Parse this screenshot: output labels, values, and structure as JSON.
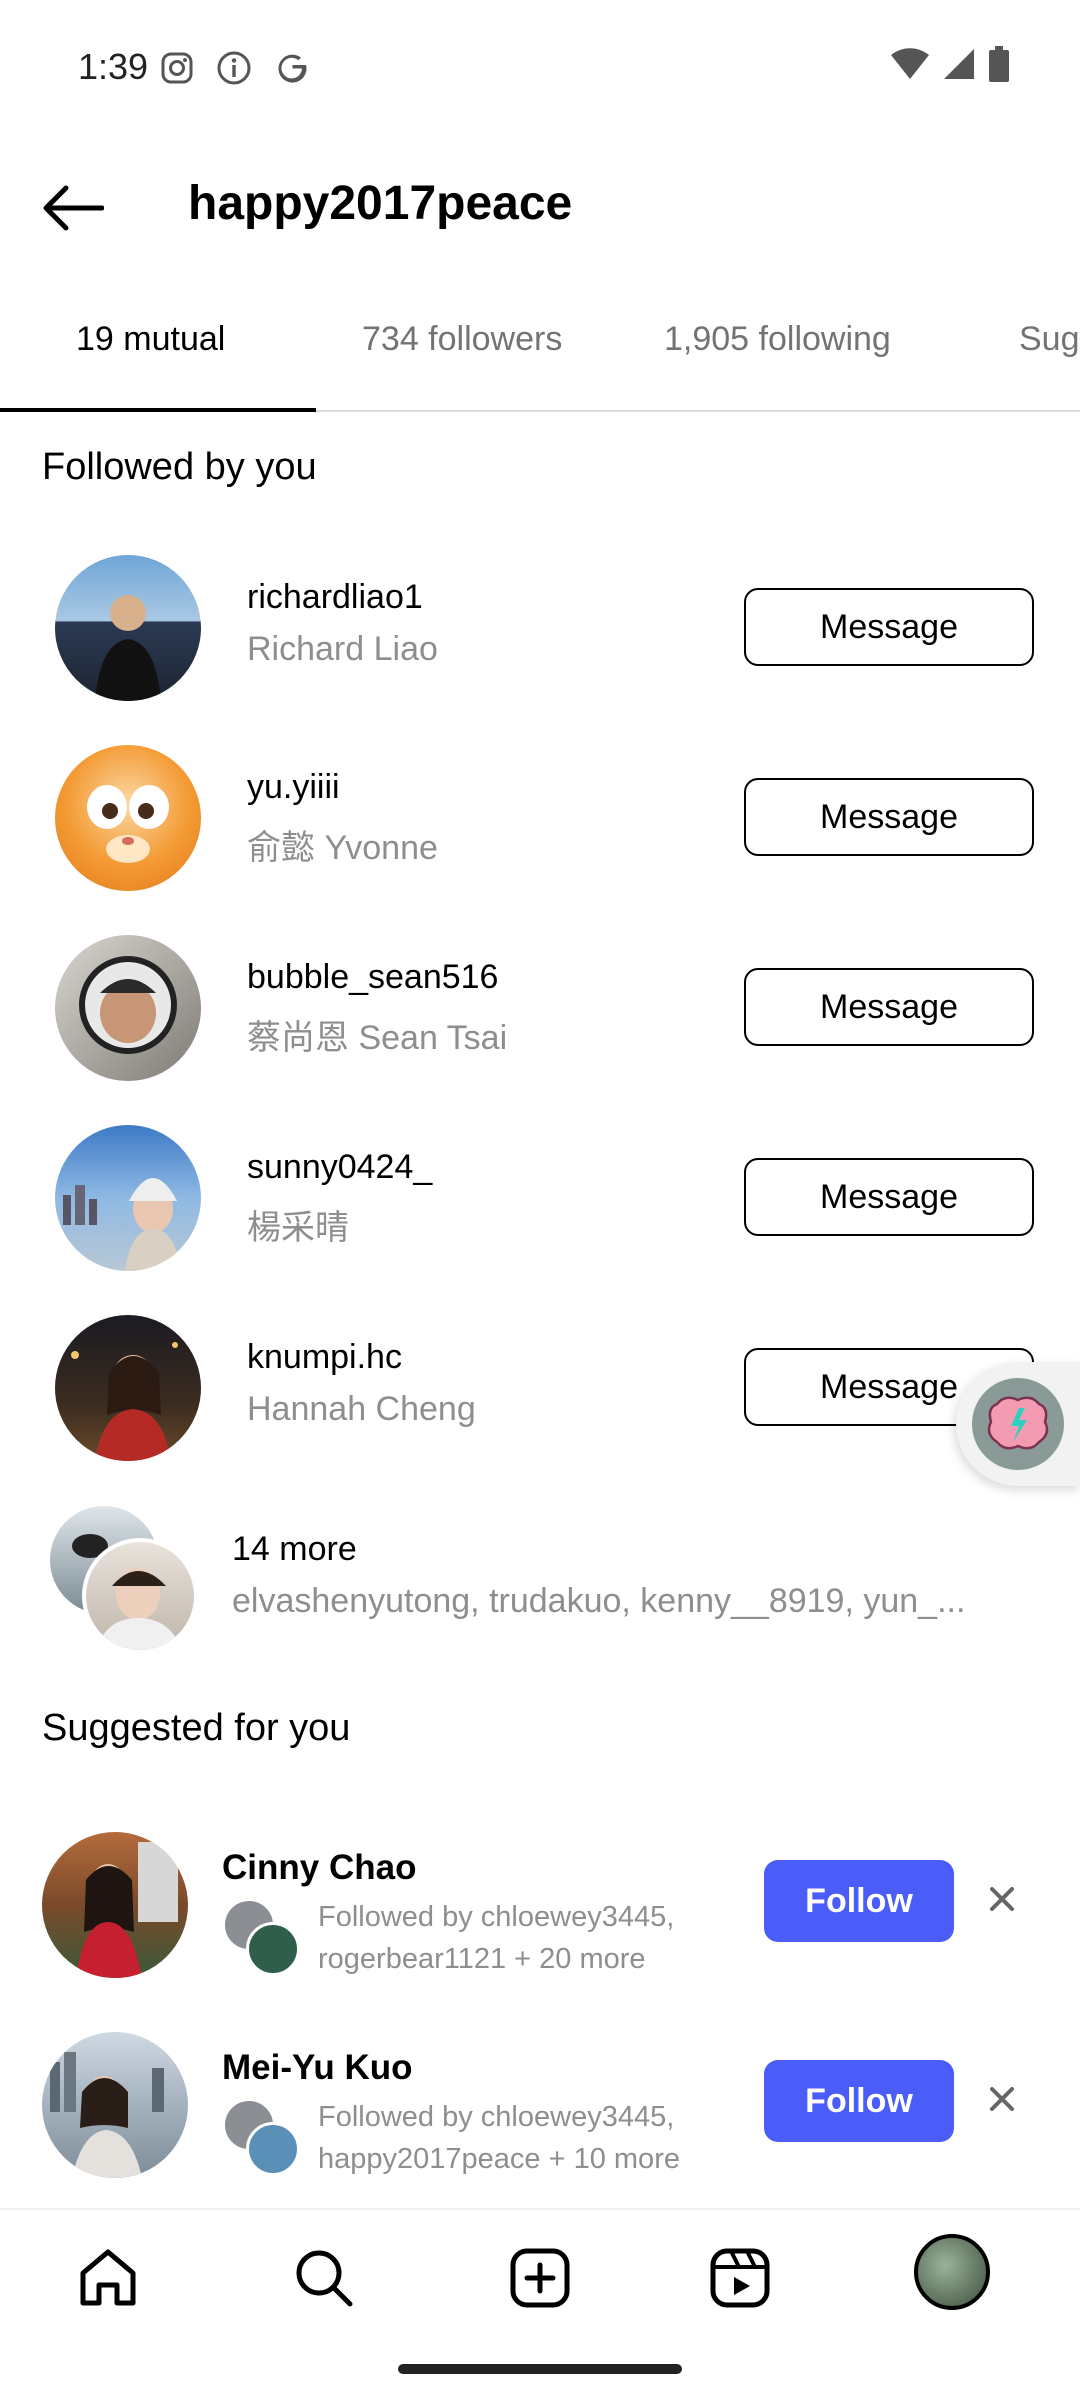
{
  "status_bar": {
    "time": "1:39"
  },
  "header": {
    "title": "happy2017peace"
  },
  "tabs": [
    {
      "label": "19 mutual"
    },
    {
      "label": "734 followers"
    },
    {
      "label": "1,905 following"
    },
    {
      "label": "Sug"
    }
  ],
  "followed_section": {
    "title": "Followed by you"
  },
  "mutuals": [
    {
      "username": "richardliao1",
      "full_name": "Richard Liao",
      "button": "Message"
    },
    {
      "username": "yu.yiiii",
      "full_name": "俞懿 Yvonne",
      "button": "Message"
    },
    {
      "username": "bubble_sean516",
      "full_name": "蔡尚恩 Sean Tsai",
      "button": "Message"
    },
    {
      "username": "sunny0424_",
      "full_name": "楊采晴",
      "button": "Message"
    },
    {
      "username": "knumpi.hc",
      "full_name": "Hannah Cheng",
      "button": "Message"
    }
  ],
  "more": {
    "title": "14 more",
    "names": "elvashenyutong, trudakuo, kenny__8919, yun_..."
  },
  "suggested_section": {
    "title": "Suggested for you"
  },
  "suggested": [
    {
      "name": "Cinny Chao",
      "line1": "Followed by chloewey3445,",
      "line2": "rogerbear1121 + 20 more",
      "button": "Follow"
    },
    {
      "name": "Mei-Yu Kuo",
      "line1": "Followed by chloewey3445,",
      "line2": "happy2017peace + 10 more",
      "button": "Follow"
    }
  ],
  "colors": {
    "follow_blue": "#4a5df9",
    "secondary_text": "#8e8e8e"
  }
}
